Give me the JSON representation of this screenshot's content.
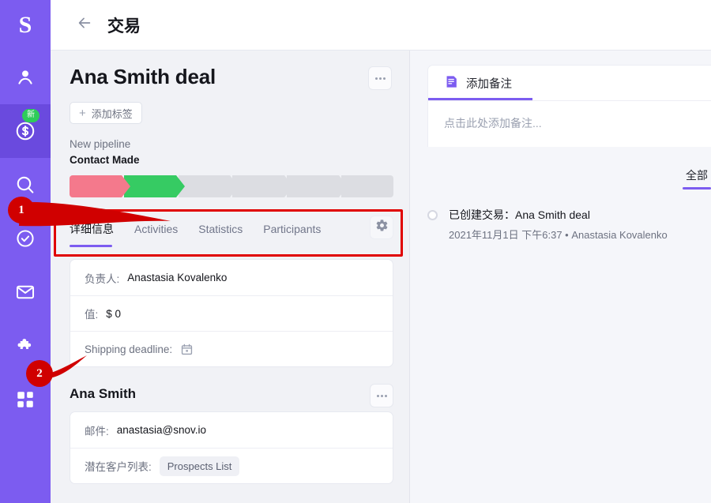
{
  "sidebar": {
    "logo": "S",
    "items": [
      {
        "name": "contacts",
        "icon": "person-icon",
        "badge": null
      },
      {
        "name": "deals",
        "icon": "dollar-coin-icon",
        "badge": "新",
        "active": true
      },
      {
        "name": "search",
        "icon": "search-icon",
        "badge": null
      },
      {
        "name": "tasks",
        "icon": "check-circle-icon",
        "badge": null
      },
      {
        "name": "email",
        "icon": "envelope-icon",
        "badge": null
      },
      {
        "name": "integrations",
        "icon": "puzzle-icon",
        "badge": null
      },
      {
        "name": "apps",
        "icon": "grid-icon",
        "badge": null
      }
    ]
  },
  "topbar": {
    "back_icon": "arrow-left-icon",
    "title": "交易"
  },
  "deal": {
    "title": "Ana Smith  deal",
    "more_label": "...",
    "add_tag_label": "添加标签",
    "add_tag_plus": "+",
    "pipeline_name": "New pipeline",
    "stage_name": "Contact Made",
    "stages": [
      {
        "label": "",
        "state": "lost"
      },
      {
        "label": "",
        "state": "won"
      },
      {
        "label": "",
        "state": "empty"
      },
      {
        "label": "",
        "state": "empty"
      },
      {
        "label": "",
        "state": "empty"
      },
      {
        "label": "",
        "state": "empty"
      }
    ]
  },
  "tabs": {
    "items": [
      {
        "label": "详细信息",
        "active": true
      },
      {
        "label": "Activities",
        "active": false
      },
      {
        "label": "Statistics",
        "active": false
      },
      {
        "label": "Participants",
        "active": false
      }
    ],
    "settings_icon": "gear-icon"
  },
  "details_card": {
    "rows": [
      {
        "label": "负责人:",
        "value": "Anastasia Kovalenko",
        "type": "text"
      },
      {
        "label": "值:",
        "value": "$ 0",
        "type": "text"
      },
      {
        "label": "Shipping deadline:",
        "value": "",
        "type": "date",
        "icon": "calendar-icon"
      }
    ]
  },
  "contact": {
    "name": "Ana Smith",
    "more_label": "...",
    "rows": [
      {
        "label": "邮件:",
        "value": "anastasia@snov.io",
        "type": "text"
      },
      {
        "label": "潜在客户列表:",
        "value": "Prospects List",
        "type": "pill"
      }
    ]
  },
  "right_panel": {
    "note_tab_label": "添加备注",
    "note_tab_icon": "note-icon",
    "note_placeholder": "点击此处添加备注...",
    "filter_label": "全部",
    "feed": [
      {
        "title": "已创建交易：Ana Smith deal",
        "meta": "2021年11月1日 下午6:37 • Anastasia Kovalenko"
      }
    ]
  },
  "annotations": [
    {
      "number": "1",
      "target": "tabs-bar"
    },
    {
      "number": "2",
      "target": "shipping-deadline-row"
    }
  ],
  "colors": {
    "brand_purple": "#7c5cf0",
    "rail_active": "#6a4ade",
    "badge_green": "#2ecc5a",
    "stage_lost": "#f4798c",
    "stage_won": "#36cb63",
    "stage_empty": "#dcdde2",
    "annotation_red": "#e00000",
    "page_bg": "#f1f2f6"
  }
}
